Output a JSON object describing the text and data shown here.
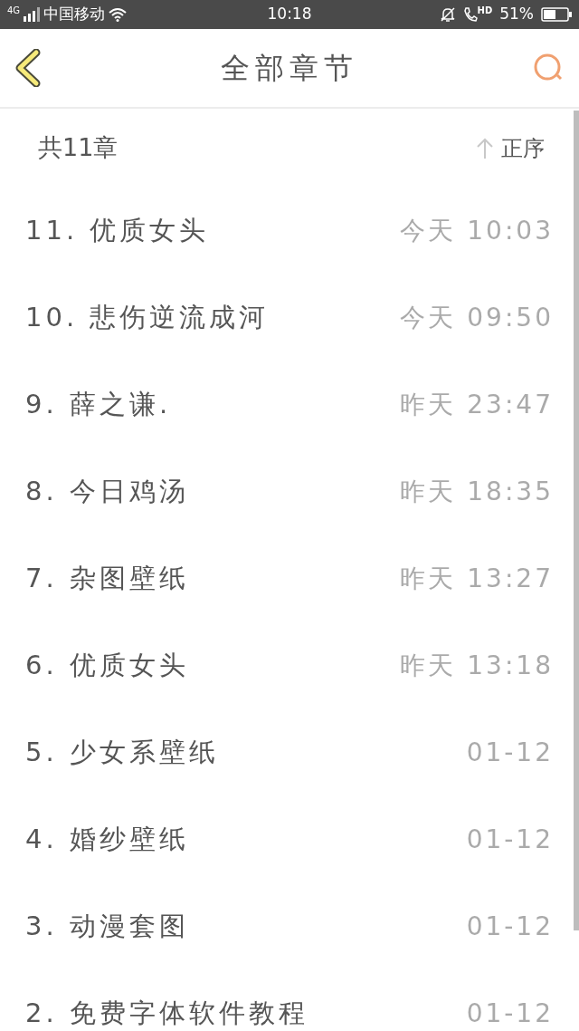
{
  "status_bar": {
    "network": "4G",
    "carrier": "中国移动",
    "time": "10:18",
    "call_badge": "HD",
    "battery": "51%"
  },
  "header": {
    "title": "全部章节"
  },
  "summary": {
    "count": "共11章",
    "sort": "正序"
  },
  "chapters": [
    {
      "title": "11. 优质女头",
      "time": "今天 10:03"
    },
    {
      "title": "10. 悲伤逆流成河",
      "time": "今天 09:50"
    },
    {
      "title": "9. 薛之谦.",
      "time": "昨天 23:47"
    },
    {
      "title": "8. 今日鸡汤",
      "time": "昨天 18:35"
    },
    {
      "title": "7. 杂图壁纸",
      "time": "昨天 13:27"
    },
    {
      "title": "6. 优质女头",
      "time": "昨天 13:18"
    },
    {
      "title": "5. 少女系壁纸",
      "time": "01-12"
    },
    {
      "title": "4. 婚纱壁纸",
      "time": "01-12"
    },
    {
      "title": "3. 动漫套图",
      "time": "01-12"
    },
    {
      "title": "2. 免费字体软件教程",
      "time": "01-12"
    }
  ]
}
